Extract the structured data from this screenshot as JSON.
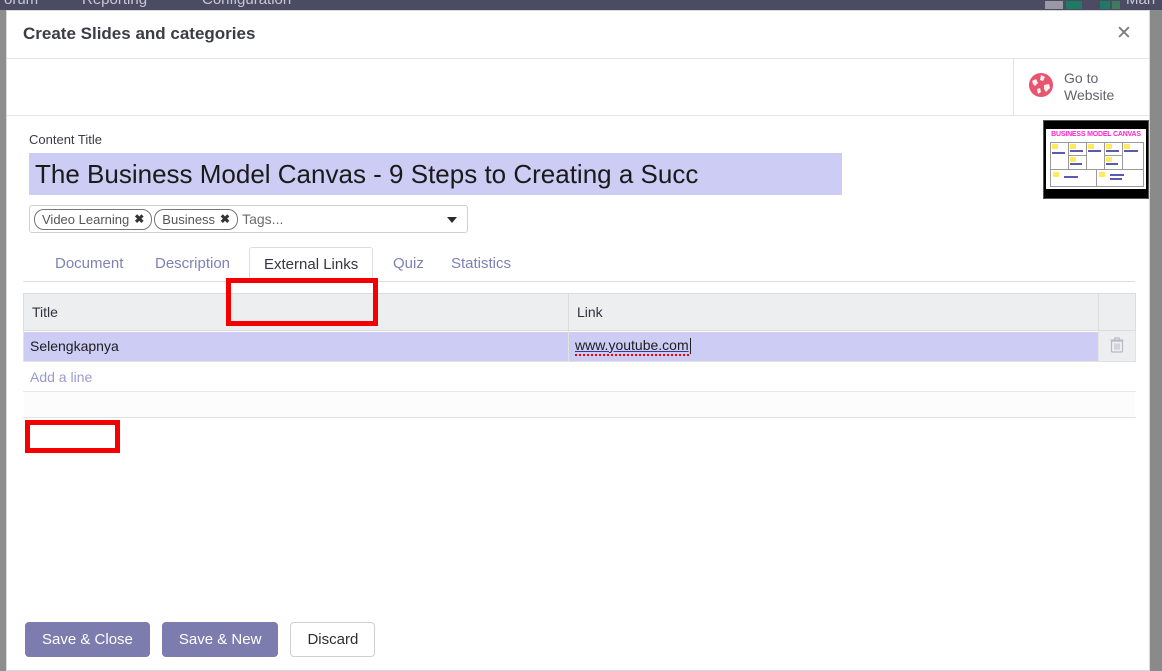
{
  "backdrop": {
    "navbar_items": [
      "orum",
      "Reporting",
      "Configuration"
    ],
    "navbar_right_user": "Mari",
    "background_color": "#f4f4f4",
    "navbar_color": "#4b4b63"
  },
  "modal": {
    "title": "Create Slides and categories",
    "close_icon": "close-icon",
    "statusbar": {
      "go_to_website_label": "Go to\nWebsite",
      "globe_icon": "globe-icon",
      "globe_color": "#e8556f"
    },
    "content_title": {
      "label": "Content Title",
      "value": "The Business Model Canvas - 9 Steps to Creating a Succ",
      "field_background": "#ccccf5"
    },
    "tags": {
      "pills": [
        {
          "label": "Video Learning",
          "remove_icon": "close-icon"
        },
        {
          "label": "Business",
          "remove_icon": "close-icon"
        }
      ],
      "placeholder": "Tags...",
      "caret_icon": "chevron-down-icon"
    },
    "thumbnail": {
      "alt": "Business Model Canvas preview",
      "heading": "BUSINESS MODEL CANVAS"
    },
    "tabs": [
      {
        "label": "Document",
        "active": false
      },
      {
        "label": "Description",
        "active": false
      },
      {
        "label": "External Links",
        "active": true
      },
      {
        "label": "Quiz",
        "active": false
      },
      {
        "label": "Statistics",
        "active": false
      }
    ],
    "links_table": {
      "columns": [
        "Title",
        "Link"
      ],
      "rows": [
        {
          "title": "Selengkapnya",
          "link": "www.youtube.com",
          "delete_icon": "trash-icon",
          "focused": true
        }
      ],
      "add_line_label": "Add a line"
    },
    "footer_buttons": [
      {
        "label": "Save & Close",
        "style": "primary"
      },
      {
        "label": "Save & New",
        "style": "primary"
      },
      {
        "label": "Discard",
        "style": "secondary"
      }
    ]
  },
  "annotations": {
    "highlight_color": "#f40000",
    "targets": [
      "external-links-tab",
      "add-a-line-link"
    ]
  }
}
